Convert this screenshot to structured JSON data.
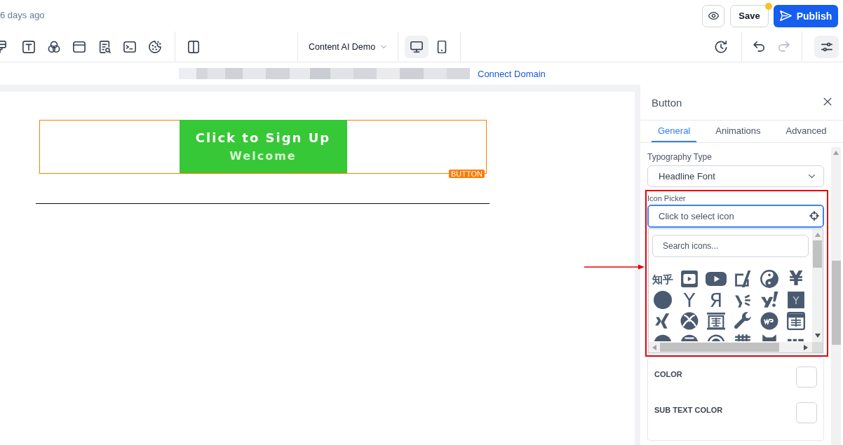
{
  "header": {
    "saved_time": "6 days ago",
    "save_button": {
      "label": "Save",
      "unsaved_changes": true
    },
    "publish_button": {
      "label": "Publish"
    }
  },
  "toolbar": {
    "page_selector": "Content AI Demo",
    "devices": [
      {
        "kind": "desktop",
        "selected": true
      },
      {
        "kind": "mobile",
        "selected": false
      }
    ],
    "history": [
      {
        "kind": "undo",
        "disabled": false
      },
      {
        "kind": "redo",
        "disabled": true
      }
    ],
    "settings_toggle": {
      "selected": true
    }
  },
  "domain_bar": {
    "link": "Connect Domain"
  },
  "canvas": {
    "button": {
      "title": "Click to Sign Up",
      "subtitle": "Welcome"
    },
    "selection_tag": "BUTTON"
  },
  "panel": {
    "title": "Button",
    "tabs": [
      {
        "label": "General",
        "selected": true
      },
      {
        "label": "Animations",
        "selected": false
      },
      {
        "label": "Advanced",
        "selected": false
      }
    ],
    "typography_type": {
      "label": "Typography Type",
      "value": "Headline Font"
    },
    "icon_picker": {
      "label": "Icon Picker",
      "placeholder": "Click to select icon",
      "expanded": true,
      "search_placeholder": "Search icons...",
      "glyphs": [
        "知乎",
        "¥",
        "Y",
        "Я"
      ]
    },
    "color_fields": [
      {
        "label": "COLOR"
      },
      {
        "label": "SUB TEXT COLOR"
      }
    ]
  }
}
